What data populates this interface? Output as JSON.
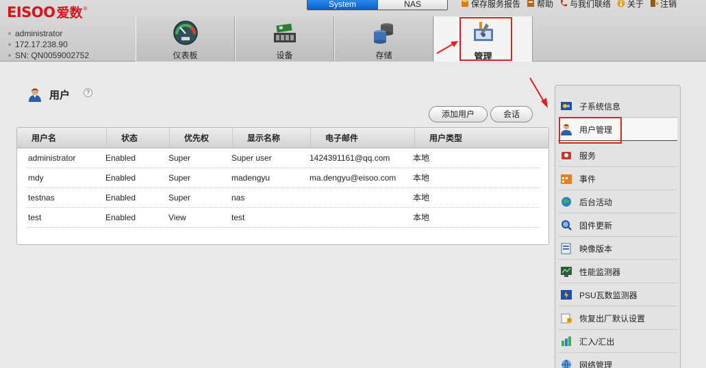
{
  "brand": {
    "logo_en": "EISOO",
    "logo_cn": "爱数",
    "reg": "®"
  },
  "user": {
    "name": "administrator",
    "ip": "172.17.238.90",
    "sn": "SN: QN0059002752"
  },
  "mode_switch": {
    "system": "System",
    "nas": "NAS",
    "active": "System"
  },
  "toplinks": {
    "save_report": "保存服务报告",
    "help": "帮助",
    "contact": "与我们联络",
    "about": "关于",
    "logout": "注销"
  },
  "navtabs": [
    {
      "label": "仪表板",
      "icon": "dashboard-gauge-icon"
    },
    {
      "label": "设备",
      "icon": "device-board-icon"
    },
    {
      "label": "存储",
      "icon": "storage-disks-icon"
    },
    {
      "label": "管理",
      "icon": "management-tools-icon",
      "active": true
    }
  ],
  "page": {
    "title": "用户",
    "help": "?",
    "actions": {
      "add_user": "添加用户",
      "session": "会话"
    }
  },
  "table": {
    "headers": [
      "用户名",
      "状态",
      "优先权",
      "显示名称",
      "电子邮件",
      "用户类型"
    ],
    "rows": [
      [
        "administrator",
        "Enabled",
        "Super",
        "Super user",
        "1424391161@qq.com",
        "本地"
      ],
      [
        "mdy",
        "Enabled",
        "Super",
        "madengyu",
        "ma.dengyu@eisoo.com",
        "本地"
      ],
      [
        "testnas",
        "Enabled",
        "Super",
        "nas",
        "",
        "本地"
      ],
      [
        "test",
        "Enabled",
        "View",
        "test",
        "",
        "本地"
      ]
    ]
  },
  "side_menu": [
    {
      "label": "子系统信息",
      "icon": "subsystem-info-icon"
    },
    {
      "label": "用户管理",
      "icon": "user-management-icon",
      "active": true
    },
    {
      "label": "服务",
      "icon": "service-icon"
    },
    {
      "label": "事件",
      "icon": "events-calendar-icon"
    },
    {
      "label": "后台活动",
      "icon": "background-activity-icon"
    },
    {
      "label": "固件更新",
      "icon": "firmware-update-icon"
    },
    {
      "label": "映像版本",
      "icon": "image-version-icon"
    },
    {
      "label": "性能监测器",
      "icon": "performance-monitor-icon"
    },
    {
      "label": "PSU瓦数监测器",
      "icon": "psu-watt-monitor-icon"
    },
    {
      "label": "恢复出厂默认设置",
      "icon": "factory-reset-icon"
    },
    {
      "label": "汇入/汇出",
      "icon": "import-export-icon"
    },
    {
      "label": "网络管理",
      "icon": "network-management-icon"
    }
  ],
  "colors": {
    "brand_red": "#d7141a",
    "highlight_red": "#e02020",
    "system_blue": "#0a5ec9"
  }
}
